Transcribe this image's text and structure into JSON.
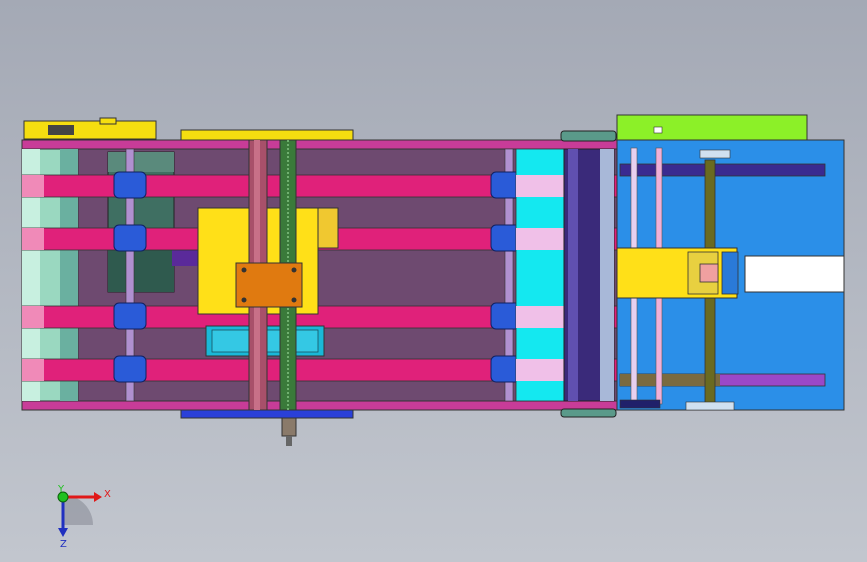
{
  "viewport": {
    "background_top": "#a4a9b5",
    "background_bottom": "#c2c6ce"
  },
  "triad": {
    "x_label": "X",
    "y_label": "Y",
    "z_label": "Z",
    "x_color": "#e01818",
    "y_color": "#20c020",
    "z_color": "#2030c0"
  },
  "model": {
    "frame_color": "#6e4a70",
    "belt_color": "#e0217a",
    "clamp_color": "#2a5bd8",
    "side_panel_color": "#2b8fe8",
    "top_plate_color": "#f5de10",
    "bottom_plate_color": "#2a40d8",
    "carriage_color": "#ffe018",
    "carriage_block_color": "#e07a10",
    "roller_color": "#9ad8c0",
    "cyan_zone_color": "#14e8f0",
    "lime_bracket_color": "#8cf028"
  }
}
